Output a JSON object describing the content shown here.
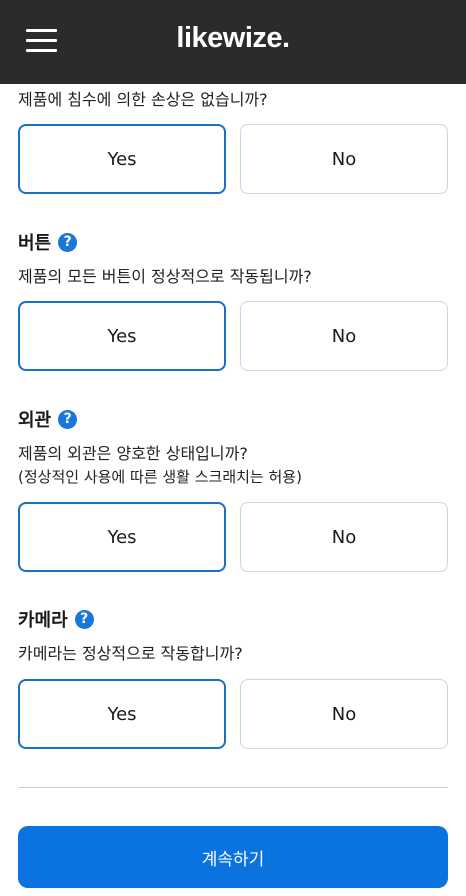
{
  "header": {
    "brand": "likewize."
  },
  "questions": [
    {
      "title": "",
      "text": "제품에 침수에 의한 손상은 없습니까?",
      "yes_label": "Yes",
      "no_label": "No",
      "selected": "yes"
    },
    {
      "title": "버튼",
      "text": "제품의 모든 버튼이 정상적으로 작동됩니까?",
      "yes_label": "Yes",
      "no_label": "No",
      "selected": "yes"
    },
    {
      "title": "외관",
      "text": "제품의 외관은 양호한 상태입니까?",
      "note": "(정상적인 사용에 따른 생활 스크래치는 허용)",
      "yes_label": "Yes",
      "no_label": "No",
      "selected": "yes"
    },
    {
      "title": "카메라",
      "text": "카메라는 정상적으로 작동합니까?",
      "yes_label": "Yes",
      "no_label": "No",
      "selected": "yes"
    }
  ],
  "help_icon_glyph": "?",
  "continue_label": "계속하기",
  "colors": {
    "header_bg": "#2b2b2b",
    "accent": "#0a73e0",
    "selected_border": "#1a6fc8",
    "help_icon": "#1877d8"
  }
}
